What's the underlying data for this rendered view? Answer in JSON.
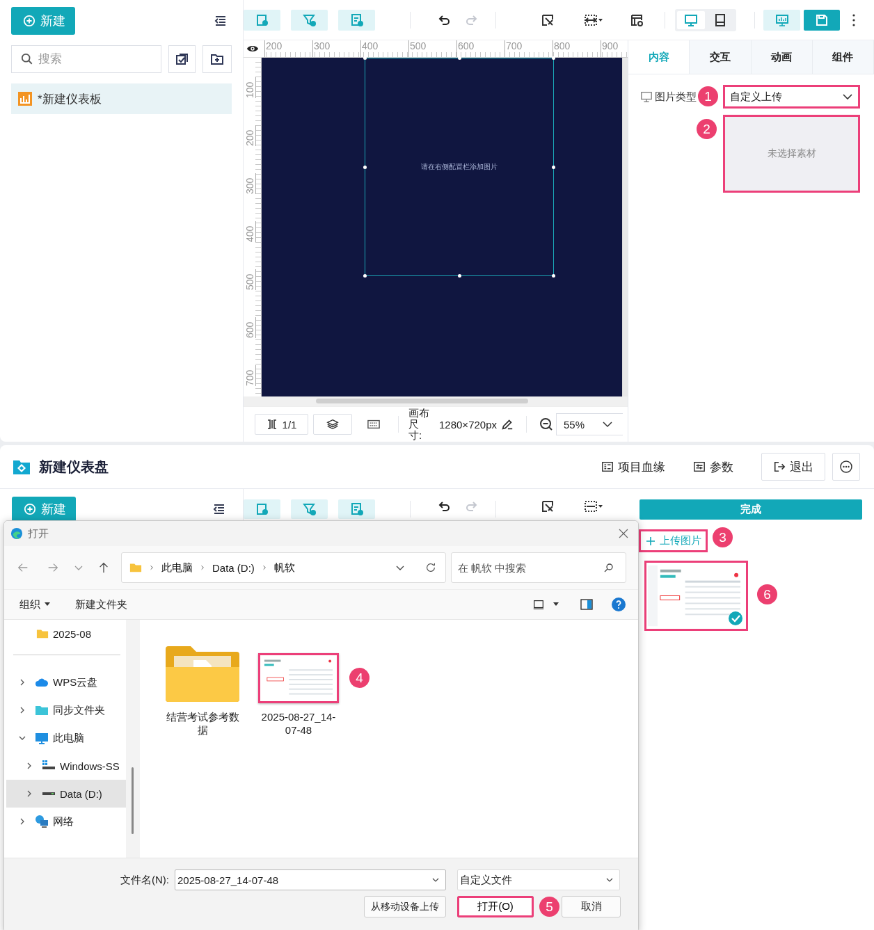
{
  "editor": {
    "new_button": "新建",
    "search": {
      "placeholder": "搜索"
    },
    "dashboards": [
      {
        "name": "*新建仪表板",
        "selected": true
      }
    ],
    "history": [
      {
        "kind": "undo",
        "disabled": false
      },
      {
        "kind": "redo",
        "disabled": true
      }
    ],
    "device_modes": [
      {
        "kind": "desktop",
        "selected": true
      },
      {
        "kind": "mobile",
        "selected": false
      }
    ],
    "ruler": {
      "x_labels": [
        "200",
        "300",
        "400",
        "500",
        "600",
        "700",
        "800",
        "900"
      ],
      "y_labels": [
        "100",
        "200",
        "300",
        "400",
        "500",
        "600",
        "700"
      ]
    },
    "canvas": {
      "hint": "请在右侧配置栏添加图片"
    },
    "footer": {
      "page": "1/1",
      "size_label": "画布尺寸:",
      "size": "1280×720px",
      "zoom": "55%"
    },
    "panel_tabs": [
      {
        "label": "内容",
        "selected": true
      },
      {
        "label": "交互",
        "selected": false
      },
      {
        "label": "动画",
        "selected": false
      },
      {
        "label": "组件",
        "selected": false
      }
    ],
    "image_type": {
      "label": "图片类型",
      "value": "自定义上传",
      "step": "1"
    },
    "material": {
      "placeholder": "未选择素材",
      "step": "2"
    }
  },
  "app": {
    "title": "新建仪表盘",
    "actions": [
      {
        "kind": "lineage",
        "label": "项目血缘"
      },
      {
        "kind": "params",
        "label": "参数"
      },
      {
        "kind": "exit",
        "label": "退出"
      }
    ],
    "new_button": "新建",
    "history": [
      {
        "kind": "undo",
        "disabled": false
      },
      {
        "kind": "redo",
        "disabled": true
      }
    ],
    "done_button": "完成",
    "upload": {
      "label": "上传图片",
      "step": "3"
    },
    "uploaded": [
      {
        "kind": "picture",
        "selected": true,
        "step": "6"
      }
    ]
  },
  "dialog": {
    "title": "打开",
    "path": [
      "此电脑",
      "Data (D:)",
      "帆软"
    ],
    "search": {
      "placeholder": "在 帆软 中搜索"
    },
    "commands": [
      {
        "kind": "menu",
        "label": "组织"
      },
      {
        "kind": "button",
        "label": "新建文件夹"
      }
    ],
    "quick_access": [
      {
        "label": "2025-08"
      }
    ],
    "tree": [
      {
        "label": "WPS云盘",
        "kind": "cloud",
        "expanded": false,
        "selected": false
      },
      {
        "label": "同步文件夹",
        "kind": "folder",
        "expanded": false,
        "selected": false
      },
      {
        "label": "此电脑",
        "kind": "computer",
        "expanded": true,
        "selected": false,
        "children": [
          {
            "label": "Windows-SS",
            "kind": "system-drive",
            "expanded": false,
            "selected": false
          },
          {
            "label": "Data (D:)",
            "kind": "drive",
            "expanded": false,
            "selected": true
          }
        ]
      },
      {
        "label": "网络",
        "kind": "network",
        "expanded": false,
        "selected": false
      }
    ],
    "files": [
      {
        "name": "结营考试参考数据",
        "kind": "folder"
      },
      {
        "name": "2025-08-27_14-07-48",
        "kind": "image",
        "step": "4"
      }
    ],
    "filename": {
      "label": "文件名(N):",
      "value": "2025-08-27_14-07-48"
    },
    "filetype": "自定义文件",
    "buttons": [
      {
        "kind": "secondary",
        "label": "从移动设备上传"
      },
      {
        "kind": "primary",
        "label": "打开(O)",
        "step": "5"
      },
      {
        "kind": "secondary",
        "label": "取消"
      }
    ]
  }
}
